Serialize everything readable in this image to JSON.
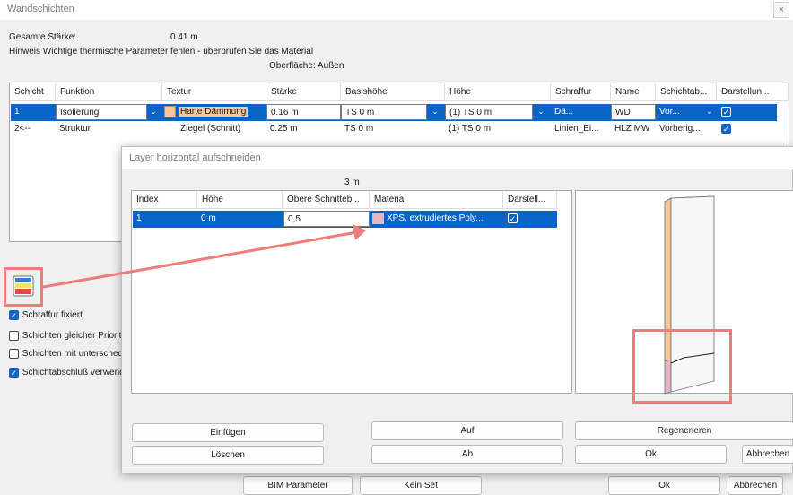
{
  "main": {
    "title": "Wandschichten",
    "close": "×",
    "total_label": "Gesamte Stärke:",
    "total_value": "0.41 m",
    "hint": "Hinweis Wichtige thermische Parameter fehlen - überprüfen Sie das Material",
    "surface": "Oberfläche: Außen",
    "columns": [
      "Schicht",
      "Funktion",
      "Textur",
      "Stärke",
      "Basishöhe",
      "Höhe",
      "Schraffur",
      "Name",
      "Schichtab...",
      "Darstellun..."
    ],
    "rows": [
      {
        "schicht": "1",
        "funktion": "Isolierung",
        "textur": "Harte Dämmung",
        "staerke": "0.16 m",
        "basis": "TS 0 m",
        "hoehe": "(1) TS 0 m",
        "schraffur": "Dä...",
        "name": "WD",
        "abschluss": "Vor...",
        "darstellung": true
      },
      {
        "schicht": "2<--",
        "funktion": "Struktur",
        "textur": "Ziegel (Schnitt)",
        "staerke": "0.25 m",
        "basis": "TS 0 m",
        "hoehe": "(1) TS 0 m",
        "schraffur": "Linien_Ei...",
        "name": "HLZ MW",
        "abschluss": "Vorherig...",
        "darstellung": true
      }
    ],
    "checkboxes": [
      {
        "label": "Schraffur fixiert",
        "checked": true
      },
      {
        "label": "Schichten gleicher Priorit",
        "checked": false
      },
      {
        "label": "Schichten mit untersched",
        "checked": false
      },
      {
        "label": "Schichtabschluß verwend",
        "checked": true
      }
    ],
    "buttons": {
      "bim": "BIM Parameter",
      "kein_set": "Kein Set",
      "ok": "Ok",
      "abbrechen": "Abbrechen"
    }
  },
  "overlay": {
    "title": "Layer horizontal aufschneiden",
    "height_label": "3 m",
    "columns": [
      "Index",
      "Höhe",
      "Obere Schnitteb...",
      "Material",
      "Darstell..."
    ],
    "rows": [
      {
        "index": "1",
        "hoehe": "0 m",
        "obere": "0,5",
        "material": "XPS, extrudiertes Poly...",
        "darstell": true
      }
    ],
    "buttons": {
      "einfuegen": "Einfügen",
      "loeschen": "Löschen",
      "auf": "Auf",
      "ab": "Ab",
      "regenerieren": "Regenerieren",
      "ok": "Ok",
      "abbrechen": "Abbrechen"
    }
  },
  "colors": {
    "selection": "#0a64c8",
    "annotation": "#f07b7b",
    "texture_swatch": "#f6c79a",
    "material_swatch": "#e6b4c2"
  },
  "icons": [
    "chevron-down-icon",
    "check-icon",
    "layer-cut-icon",
    "close-icon"
  ]
}
